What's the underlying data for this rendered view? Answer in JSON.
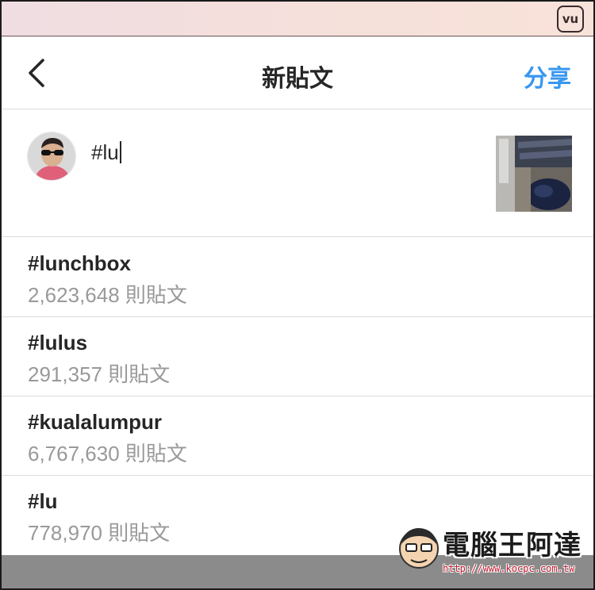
{
  "badge": {
    "label": "vu"
  },
  "nav": {
    "title": "新貼文",
    "share_label": "分享"
  },
  "composer": {
    "caption": "#lu"
  },
  "suggestions": [
    {
      "tag": "#lunchbox",
      "count": "2,623,648 則貼文"
    },
    {
      "tag": "#lulus",
      "count": "291,357 則貼文"
    },
    {
      "tag": "#kualalumpur",
      "count": "6,767,630 則貼文"
    },
    {
      "tag": "#lu",
      "count": "778,970 則貼文"
    }
  ],
  "watermark": {
    "text": "電腦王阿達",
    "url": "http://www.kocpc.com.tw"
  },
  "colors": {
    "accent": "#3897f0",
    "muted": "#999999",
    "text": "#262626",
    "divider": "#dbdbdb"
  }
}
